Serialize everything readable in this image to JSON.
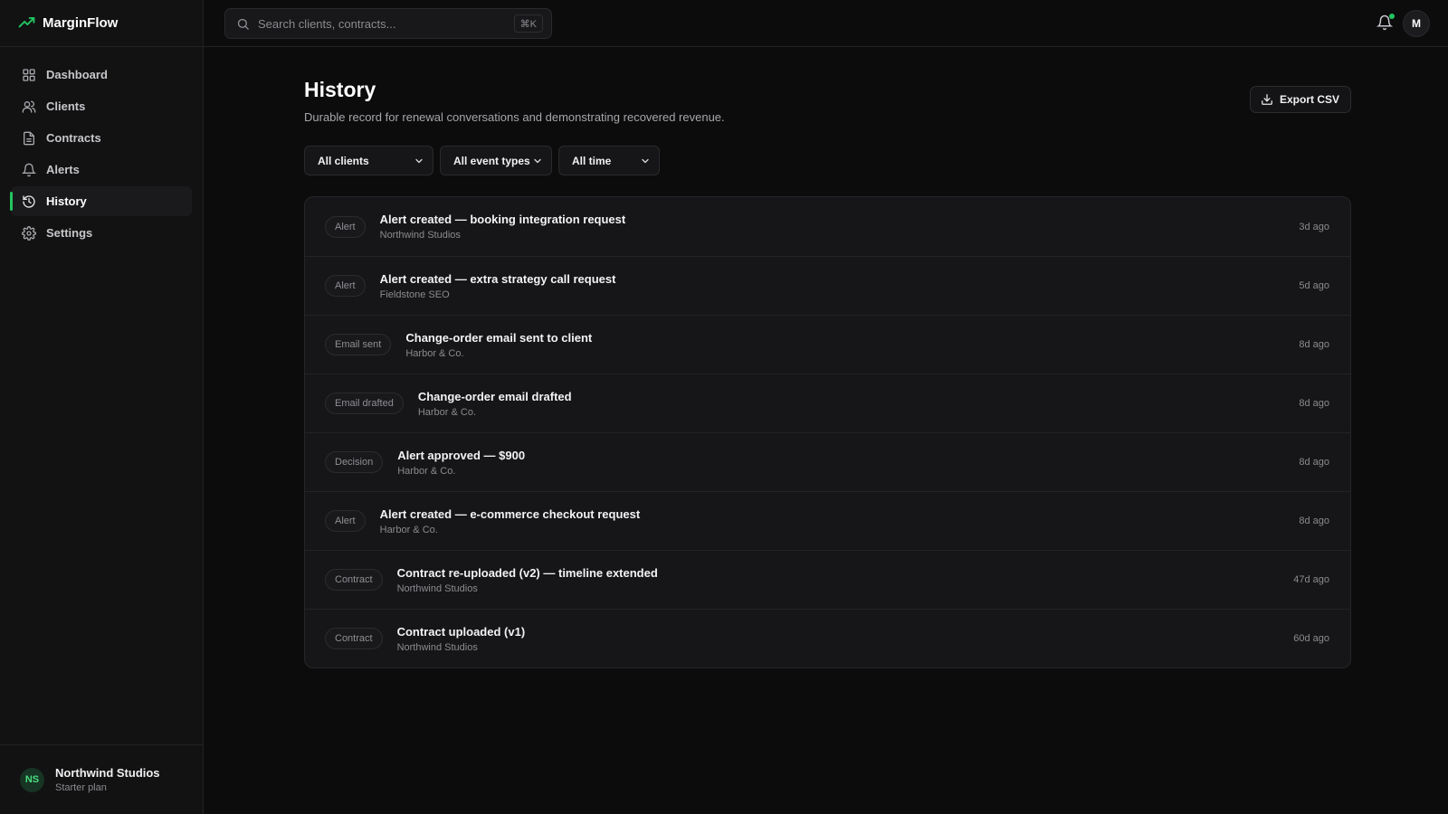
{
  "brand": {
    "name": "MarginFlow"
  },
  "sidebar": {
    "items": [
      {
        "label": "Dashboard",
        "icon": "grid-icon",
        "active": false
      },
      {
        "label": "Clients",
        "icon": "users-icon",
        "active": false
      },
      {
        "label": "Contracts",
        "icon": "document-icon",
        "active": false
      },
      {
        "label": "Alerts",
        "icon": "bell-icon",
        "active": false
      },
      {
        "label": "History",
        "icon": "history-icon",
        "active": true
      },
      {
        "label": "Settings",
        "icon": "gear-icon",
        "active": false
      }
    ],
    "workspace": {
      "initials": "NS",
      "name": "Northwind Studios",
      "plan": "Starter plan"
    }
  },
  "topbar": {
    "search_placeholder": "Search clients, contracts...",
    "shortcut": "⌘K",
    "avatar_initial": "M"
  },
  "page": {
    "title": "History",
    "subtitle": "Durable record for renewal conversations and demonstrating recovered revenue.",
    "export_label": "Export CSV"
  },
  "filters": [
    {
      "selected": "All clients"
    },
    {
      "selected": "All event types"
    },
    {
      "selected": "All time"
    }
  ],
  "events": [
    {
      "type": "Alert",
      "title": "Alert created — booking integration request",
      "client": "Northwind Studios",
      "time": "3d ago"
    },
    {
      "type": "Alert",
      "title": "Alert created — extra strategy call request",
      "client": "Fieldstone SEO",
      "time": "5d ago"
    },
    {
      "type": "Email sent",
      "title": "Change-order email sent to client",
      "client": "Harbor & Co.",
      "time": "8d ago"
    },
    {
      "type": "Email drafted",
      "title": "Change-order email drafted",
      "client": "Harbor & Co.",
      "time": "8d ago"
    },
    {
      "type": "Decision",
      "title": "Alert approved — $900",
      "client": "Harbor & Co.",
      "time": "8d ago"
    },
    {
      "type": "Alert",
      "title": "Alert created — e-commerce checkout request",
      "client": "Harbor & Co.",
      "time": "8d ago"
    },
    {
      "type": "Contract",
      "title": "Contract re-uploaded (v2) — timeline extended",
      "client": "Northwind Studios",
      "time": "47d ago"
    },
    {
      "type": "Contract",
      "title": "Contract uploaded (v1)",
      "client": "Northwind Studios",
      "time": "60d ago"
    }
  ],
  "colors": {
    "accent": "#22c55e",
    "background": "#0c0c0d",
    "panel": "#161618"
  }
}
